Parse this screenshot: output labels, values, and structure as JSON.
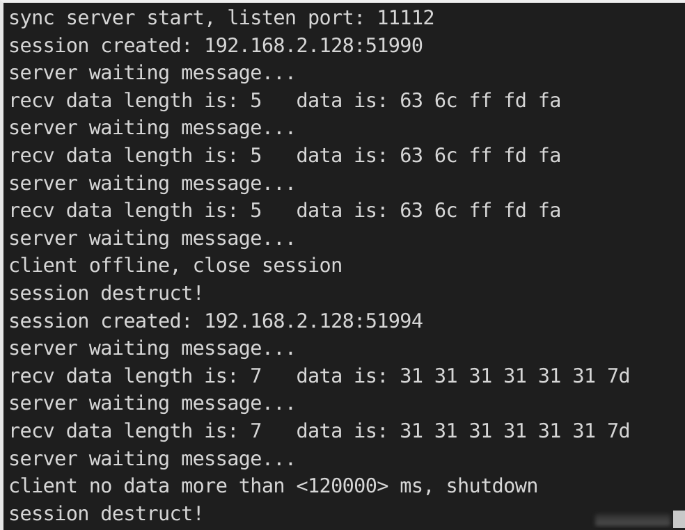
{
  "window": {
    "kind": "console-log-output",
    "background_color": "#1e1e1e",
    "text_color": "#d6d6d6",
    "border_color": "#e8e8e8"
  },
  "console": {
    "lines": [
      "sync server start, listen port: 11112",
      "session created: 192.168.2.128:51990",
      "server waiting message...",
      "recv data length is: 5   data is: 63 6c ff fd fa",
      "server waiting message...",
      "recv data length is: 5   data is: 63 6c ff fd fa",
      "server waiting message...",
      "recv data length is: 5   data is: 63 6c ff fd fa",
      "server waiting message...",
      "client offline, close session",
      "session destruct!",
      "session created: 192.168.2.128:51994",
      "server waiting message...",
      "recv data length is: 7   data is: 31 31 31 31 31 31 7d",
      "server waiting message...",
      "recv data length is: 7   data is: 31 31 31 31 31 31 7d",
      "server waiting message...",
      "client no data more than <120000> ms, shutdown",
      "session destruct!"
    ]
  }
}
